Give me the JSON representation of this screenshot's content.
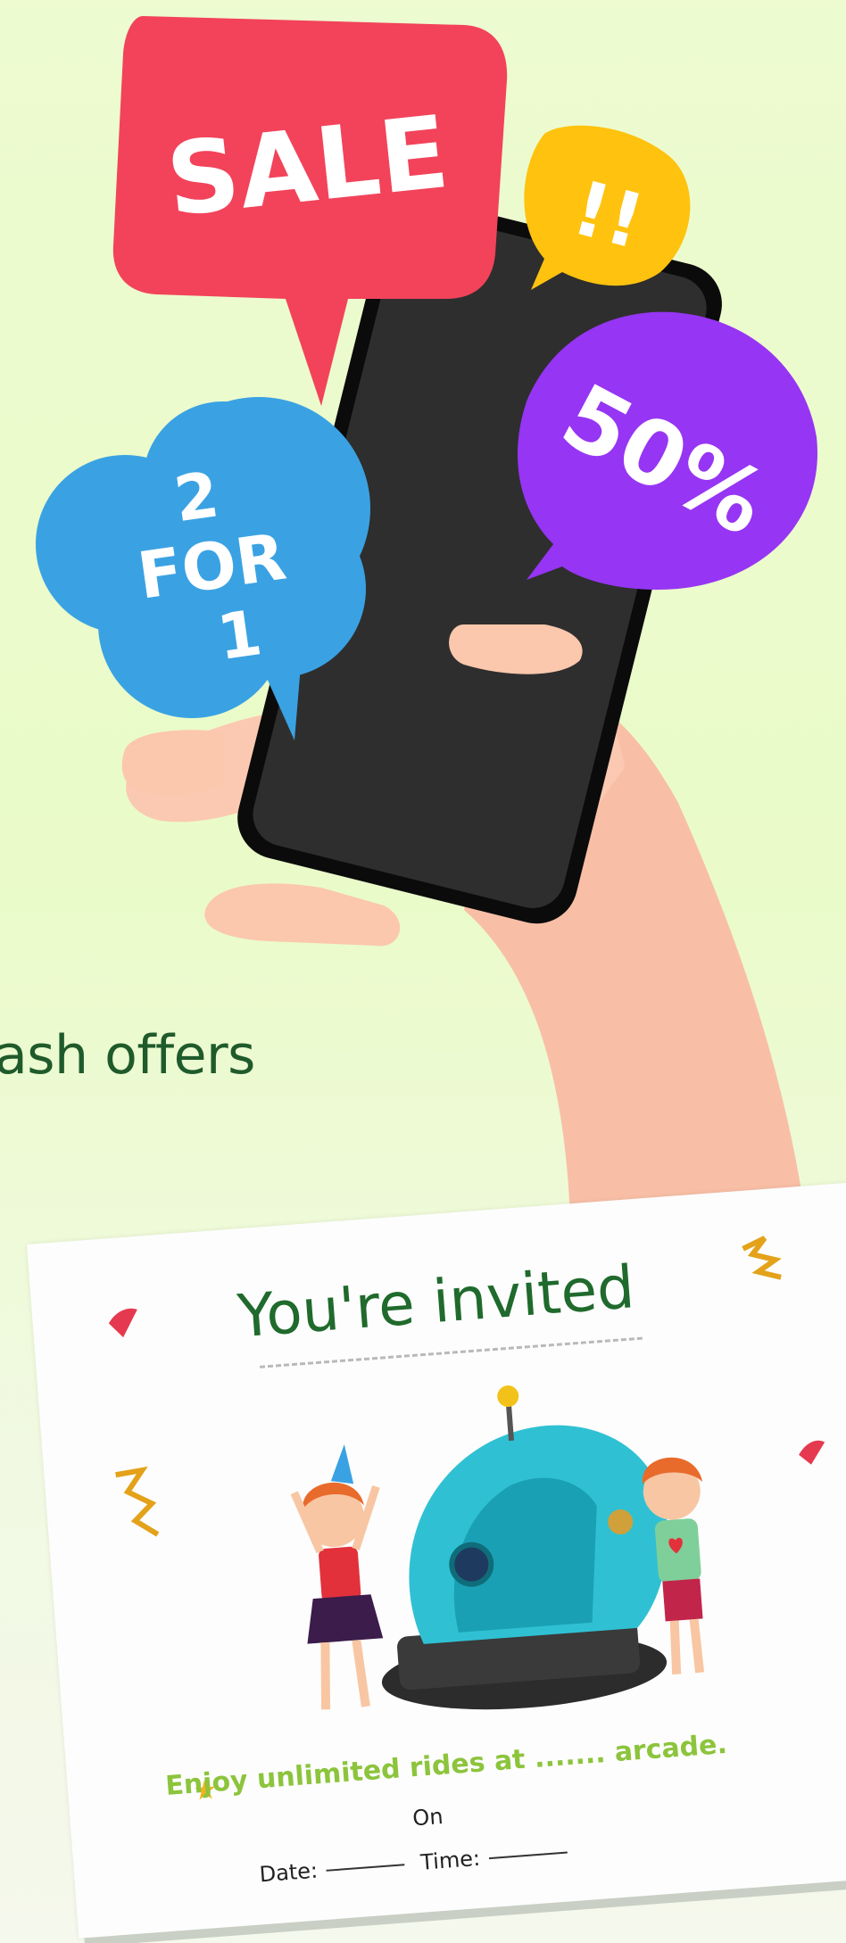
{
  "promo": {
    "sale_label": "SALE",
    "exclaim_label": "!!",
    "percent_label": "50%",
    "bogo_line1": "2",
    "bogo_line2": "FOR",
    "bogo_line3": "1",
    "partial_caption": "ash offers"
  },
  "invitation": {
    "title": "You're invited",
    "offer_text": "Enjoy unlimited rides at ....... arcade.",
    "on_label": "On",
    "date_label": "Date:",
    "time_label": "Time:"
  },
  "colors": {
    "sale": "#f2435a",
    "exclaim": "#ffc20e",
    "percent": "#9635f3",
    "bogo": "#3aa2e3",
    "caption": "#1f5a2b",
    "offer_text": "#8cc43c"
  }
}
